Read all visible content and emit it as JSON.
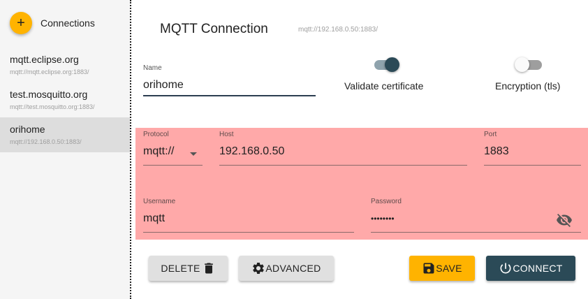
{
  "sidebar": {
    "title": "Connections",
    "add_icon": "+",
    "items": [
      {
        "name": "mqtt.eclipse.org",
        "url": "mqtt://mqtt.eclipse.org:1883/"
      },
      {
        "name": "test.mosquitto.org",
        "url": "mqtt://test.mosquitto.org:1883/"
      },
      {
        "name": "orihome",
        "url": "mqtt://192.168.0.50:1883/",
        "selected": true
      }
    ]
  },
  "header": {
    "title": "MQTT Connection",
    "url": "mqtt://192.168.0.50:1883/"
  },
  "form": {
    "name": {
      "label": "Name",
      "value": "orihome"
    },
    "validate_certificate": {
      "label": "Validate certificate",
      "on": true
    },
    "encryption": {
      "label": "Encryption (tls)",
      "on": false
    },
    "protocol": {
      "label": "Protocol",
      "value": "mqtt://"
    },
    "host": {
      "label": "Host",
      "value": "192.168.0.50"
    },
    "port": {
      "label": "Port",
      "value": "1883"
    },
    "username": {
      "label": "Username",
      "value": "mqtt"
    },
    "password": {
      "label": "Password",
      "value": "••••••••"
    },
    "panel_color": "#ffa9a9"
  },
  "buttons": {
    "delete": "DELETE",
    "advanced": "ADVANCED",
    "save": "SAVE",
    "connect": "CONNECT"
  },
  "icons": {
    "add": "plus-icon",
    "delete": "trash-icon",
    "advanced": "gear-icon",
    "save": "floppy-disk-icon",
    "connect": "power-icon",
    "password_toggle": "eye-off-icon",
    "protocol_dropdown": "caret-down-icon"
  },
  "colors": {
    "accent": "#ffb300",
    "primary_dark": "#2b4a57"
  }
}
